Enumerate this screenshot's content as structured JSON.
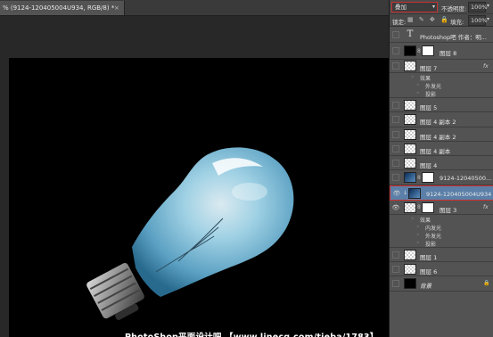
{
  "document": {
    "tab_title": "% (9124-120405004U934, RGB/8) *",
    "close_glyph": "×"
  },
  "layers_panel": {
    "blend_mode": "叠加",
    "opacity_label": "不透明度:",
    "opacity_value": "100%",
    "lock_label": "锁定:",
    "fill_label": "填充:",
    "fill_value": "100%",
    "layers": [
      {
        "name": "Photoshop吧 作者：明...",
        "kind": "type",
        "visible": false
      },
      {
        "name": "图层 8",
        "kind": "masked",
        "visible": false
      },
      {
        "name": "图层 7",
        "kind": "normal",
        "visible": false,
        "fx": "fx",
        "effects_label": "效果",
        "effects": [
          "外发光",
          "投影"
        ]
      },
      {
        "name": "图层 5",
        "kind": "normal",
        "visible": false
      },
      {
        "name": "图层 4 副本 2",
        "kind": "normal",
        "visible": false
      },
      {
        "name": "图层 4 副本 2",
        "kind": "normal",
        "visible": false
      },
      {
        "name": "图层 4 副本",
        "kind": "normal",
        "visible": false
      },
      {
        "name": "图层 4",
        "kind": "normal",
        "visible": false
      },
      {
        "name": "9124-12040500...",
        "kind": "photo-masked",
        "visible": false
      },
      {
        "name": "9124-120405004U934",
        "kind": "photo",
        "visible": true,
        "selected": true
      },
      {
        "name": "图层 3",
        "kind": "normal",
        "visible": true,
        "fx": "fx",
        "effects_label": "效果",
        "effects": [
          "内发光",
          "外发光",
          "投影"
        ]
      },
      {
        "name": "图层 1",
        "kind": "normal",
        "visible": false
      },
      {
        "name": "图层 6",
        "kind": "normal",
        "visible": false
      },
      {
        "name": "背景",
        "kind": "background",
        "visible": false,
        "locked": true
      }
    ]
  },
  "caption": "PhotoShop平面设计吧 【www.linecg.com/tieba/1783】",
  "colors": {
    "panel_bg": "#535353",
    "selected_layer": "#5a7fa8",
    "highlight_border": "#d03030",
    "canvas_bg": "#000000",
    "bulb_glass": "#9fd4ec"
  },
  "icons": {
    "eye": "eye-icon",
    "lock": "lock-icon",
    "link": "chain-link-icon",
    "fx": "fx-icon"
  }
}
